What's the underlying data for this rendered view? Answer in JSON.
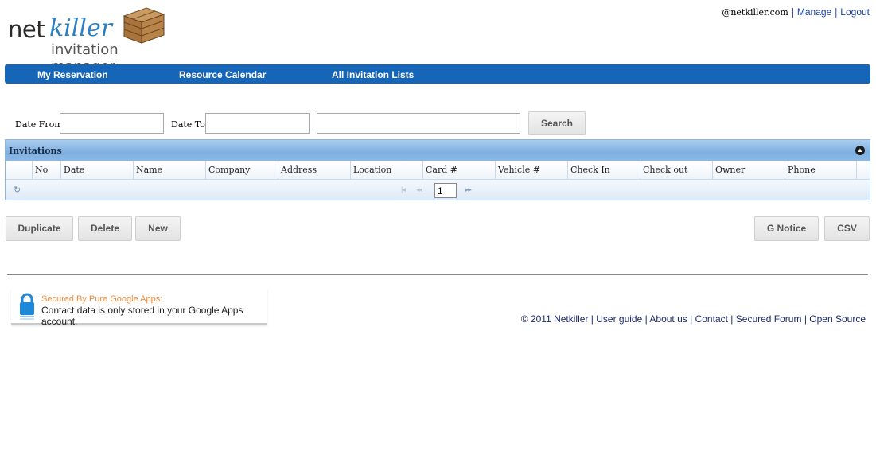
{
  "header": {
    "logo": {
      "word1": "net",
      "word2": "killer",
      "subtitle": "invitation manager"
    },
    "user_domain": "@netkiller.com",
    "links": {
      "manage": "Manage",
      "logout": "Logout",
      "sep": "|"
    }
  },
  "nav": {
    "items": [
      "My Reservation",
      "Resource Calendar",
      "All Invitation Lists"
    ]
  },
  "search": {
    "date_from_label": "Date From :",
    "date_from_value": "",
    "date_to_label": "Date To :",
    "date_to_value": "",
    "keyword_value": "",
    "search_button": "Search"
  },
  "grid": {
    "caption": "Invitations",
    "columns": [
      "No",
      "Date",
      "Name",
      "Company",
      "Address",
      "Location",
      "Card #",
      "Vehicle #",
      "Check In",
      "Check out",
      "Owner",
      "Phone"
    ],
    "page": "1",
    "pager_first": "|◂",
    "pager_prev": "◂◂",
    "pager_next": "▸▸",
    "refresh_icon": "refresh-icon"
  },
  "actions": {
    "duplicate": "Duplicate",
    "delete": "Delete",
    "new": "New",
    "g_notice": "G Notice",
    "csv": "CSV"
  },
  "footer": {
    "secured_title": "Secured By Pure Google Apps:",
    "secured_text": "Contact data is only stored in your Google Apps account.",
    "copyright": "© 2011 Netkiller",
    "links": [
      "User guide",
      "About us",
      "Contact",
      "Secured Forum",
      "Open Source"
    ],
    "sep": "|"
  },
  "colors": {
    "nav_bg": "#1565b8",
    "link": "#1a3fa8",
    "accent_orange": "#f08a3c",
    "grid_border": "#8fb4d8"
  }
}
